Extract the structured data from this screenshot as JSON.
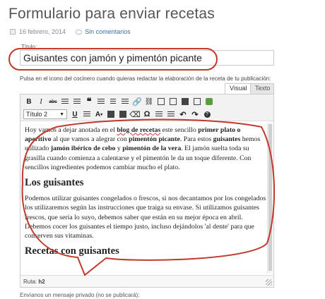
{
  "page": {
    "title": "Formulario para enviar recetas",
    "date": "16 febrero, 2014",
    "comments": "Sin comentarios"
  },
  "form": {
    "title_label": "Título:",
    "title_value": "Guisantes con jamón y pimentón picante",
    "hint": "Pulsa en el icono del cocinero cuando quieras redactar la elaboración de la receta de tu publicación:",
    "bottom_note": "Envíanos un mensaje privado (no se publicará):"
  },
  "editor": {
    "tab_visual": "Visual",
    "tab_text": "Texto",
    "format_select": "Título 2",
    "status_label": "Ruta:",
    "status_path": "h2",
    "toolbar_row1": [
      "B",
      "I",
      "ABC",
      "•≡",
      "1≡",
      "❝",
      "align-left",
      "align-center",
      "align-right",
      "link",
      "unlink",
      "more",
      "fullscreen",
      "table",
      "kitchen",
      "chef"
    ],
    "toolbar_row2": [
      "U",
      "justify",
      "A",
      "paste-text",
      "paste-word",
      "eraser",
      "Ω",
      "outdent",
      "indent",
      "undo",
      "redo",
      "help"
    ],
    "p1": {
      "t1": "Hoy vamos a dejar anotada en el ",
      "b1": "blog de recetas",
      "t2": " este sencillo ",
      "b2": "primer plato o aperitivo",
      "t3": " al que vamos a alegrar con ",
      "b3": "pimentón picante",
      "t4": ". Para estos ",
      "b4": "guisantes",
      "t5": " hemos utilizado ",
      "b5": "jamón ibérico de cebo",
      "t6": " y ",
      "b6": "pimentón de la vera",
      "t7": ". El jamón suelta toda su grasilla cuando comienza a calentarse y el pimentón le da un toque diferente. Con sencillos ingredientes podemos cambiar mucho el plato."
    },
    "h1": "Los guisantes",
    "p2": "Podemos utilizar guisantes congelados o frescos, si nos decantamos por los congelados los utilizaremos según las instrucciones que traiga su envase. Si utilizamos guisantes frescos, que sería lo suyo, debemos saber que están en su mejor época en abril. Debemos cocer los guisantes el tiempo justo, incluso dejándolos 'al dente' para que conserven sus vitaminas.",
    "h2": "Recetas con guisantes"
  },
  "colors": {
    "annotation": "#c0392b",
    "link": "#3a6ea5"
  }
}
